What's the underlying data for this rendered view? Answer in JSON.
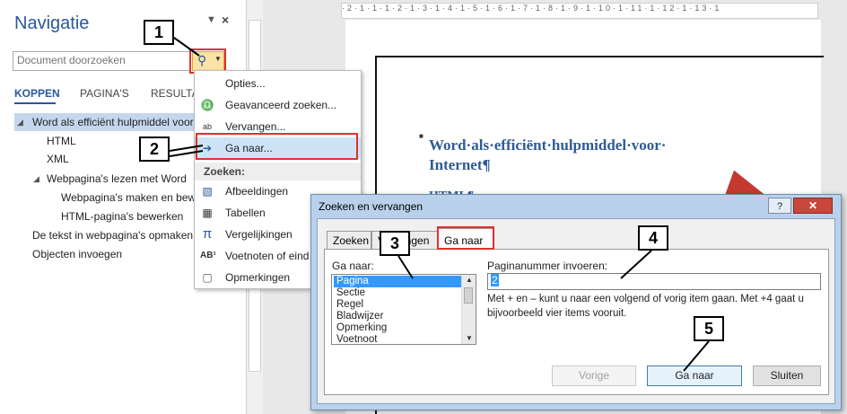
{
  "nav": {
    "title": "Navigatie",
    "pin_icon": "pin-dropdown-icon",
    "close_glyph": "×",
    "search_placeholder": "Document doorzoeken",
    "tabs": [
      "KOPPEN",
      "PAGINA'S",
      "RESULTA"
    ],
    "tree": [
      {
        "label": "Word als efficiënt hulpmiddel voor",
        "level": 0,
        "expanded": true,
        "selected": true
      },
      {
        "label": "HTML",
        "level": 1
      },
      {
        "label": "XML",
        "level": 1
      },
      {
        "label": "Webpagina's lezen met Word",
        "level": 1,
        "expanded": true
      },
      {
        "label": "Webpagina's maken en bewe",
        "level": 2
      },
      {
        "label": "HTML-pagina's bewerken",
        "level": 2
      },
      {
        "label": "De tekst in webpagina's opmaken",
        "level": 0
      },
      {
        "label": "Objecten invoegen",
        "level": 0
      }
    ]
  },
  "menu": {
    "items": [
      {
        "label": "Opties...",
        "icon": "none"
      },
      {
        "label": "Geavanceerd zoeken...",
        "icon": "binoculars-icon"
      },
      {
        "label": "Vervangen...",
        "icon": "replace-icon"
      },
      {
        "label": "Ga naar...",
        "icon": "arrow-right-icon"
      }
    ],
    "section": "Zoeken:",
    "find_items": [
      {
        "label": "Afbeeldingen",
        "icon": "image-icon"
      },
      {
        "label": "Tabellen",
        "icon": "table-icon"
      },
      {
        "label": "Vergelijkingen",
        "icon": "pi-icon"
      },
      {
        "label": "Voetnoten of eind",
        "icon": "footnote-icon"
      },
      {
        "label": "Opmerkingen",
        "icon": "comment-icon"
      }
    ]
  },
  "document": {
    "heading": "Word·als·efficiënt·hulpmiddel·voor· Internet¶",
    "partial_heading": "HTML¶",
    "ruler_text": "·2·1·1·1·2·1·3·1·4·1·5·1·6·1·7·1·8·1·9·1·10·1·11·1·12·1·13·1"
  },
  "dialog": {
    "title": "Zoeken en vervangen",
    "help_glyph": "?",
    "close_glyph": "✕",
    "tabs": [
      "Zoeken",
      "Vervangen",
      "Ga naar"
    ],
    "goto_label": "Ga naar:",
    "goto_items": [
      "Pagina",
      "Sectie",
      "Regel",
      "Bladwijzer",
      "Opmerking",
      "Voetnoot"
    ],
    "selected_item": "Pagina",
    "pagenum_label": "Paginanummer invoeren:",
    "pagenum_value": "2",
    "hint": "Met + en – kunt u naar een volgend of vorig item gaan. Met +4 gaat u bijvoorbeeld vier items vooruit.",
    "buttons": {
      "previous": "Vorige",
      "goto": "Ga naar",
      "close": "Sluiten"
    }
  },
  "callouts": [
    "1",
    "2",
    "3",
    "4",
    "5"
  ],
  "colors": {
    "accent": "#2b579a",
    "callout_border": "#e0312a",
    "heading": "#2e5c96"
  }
}
